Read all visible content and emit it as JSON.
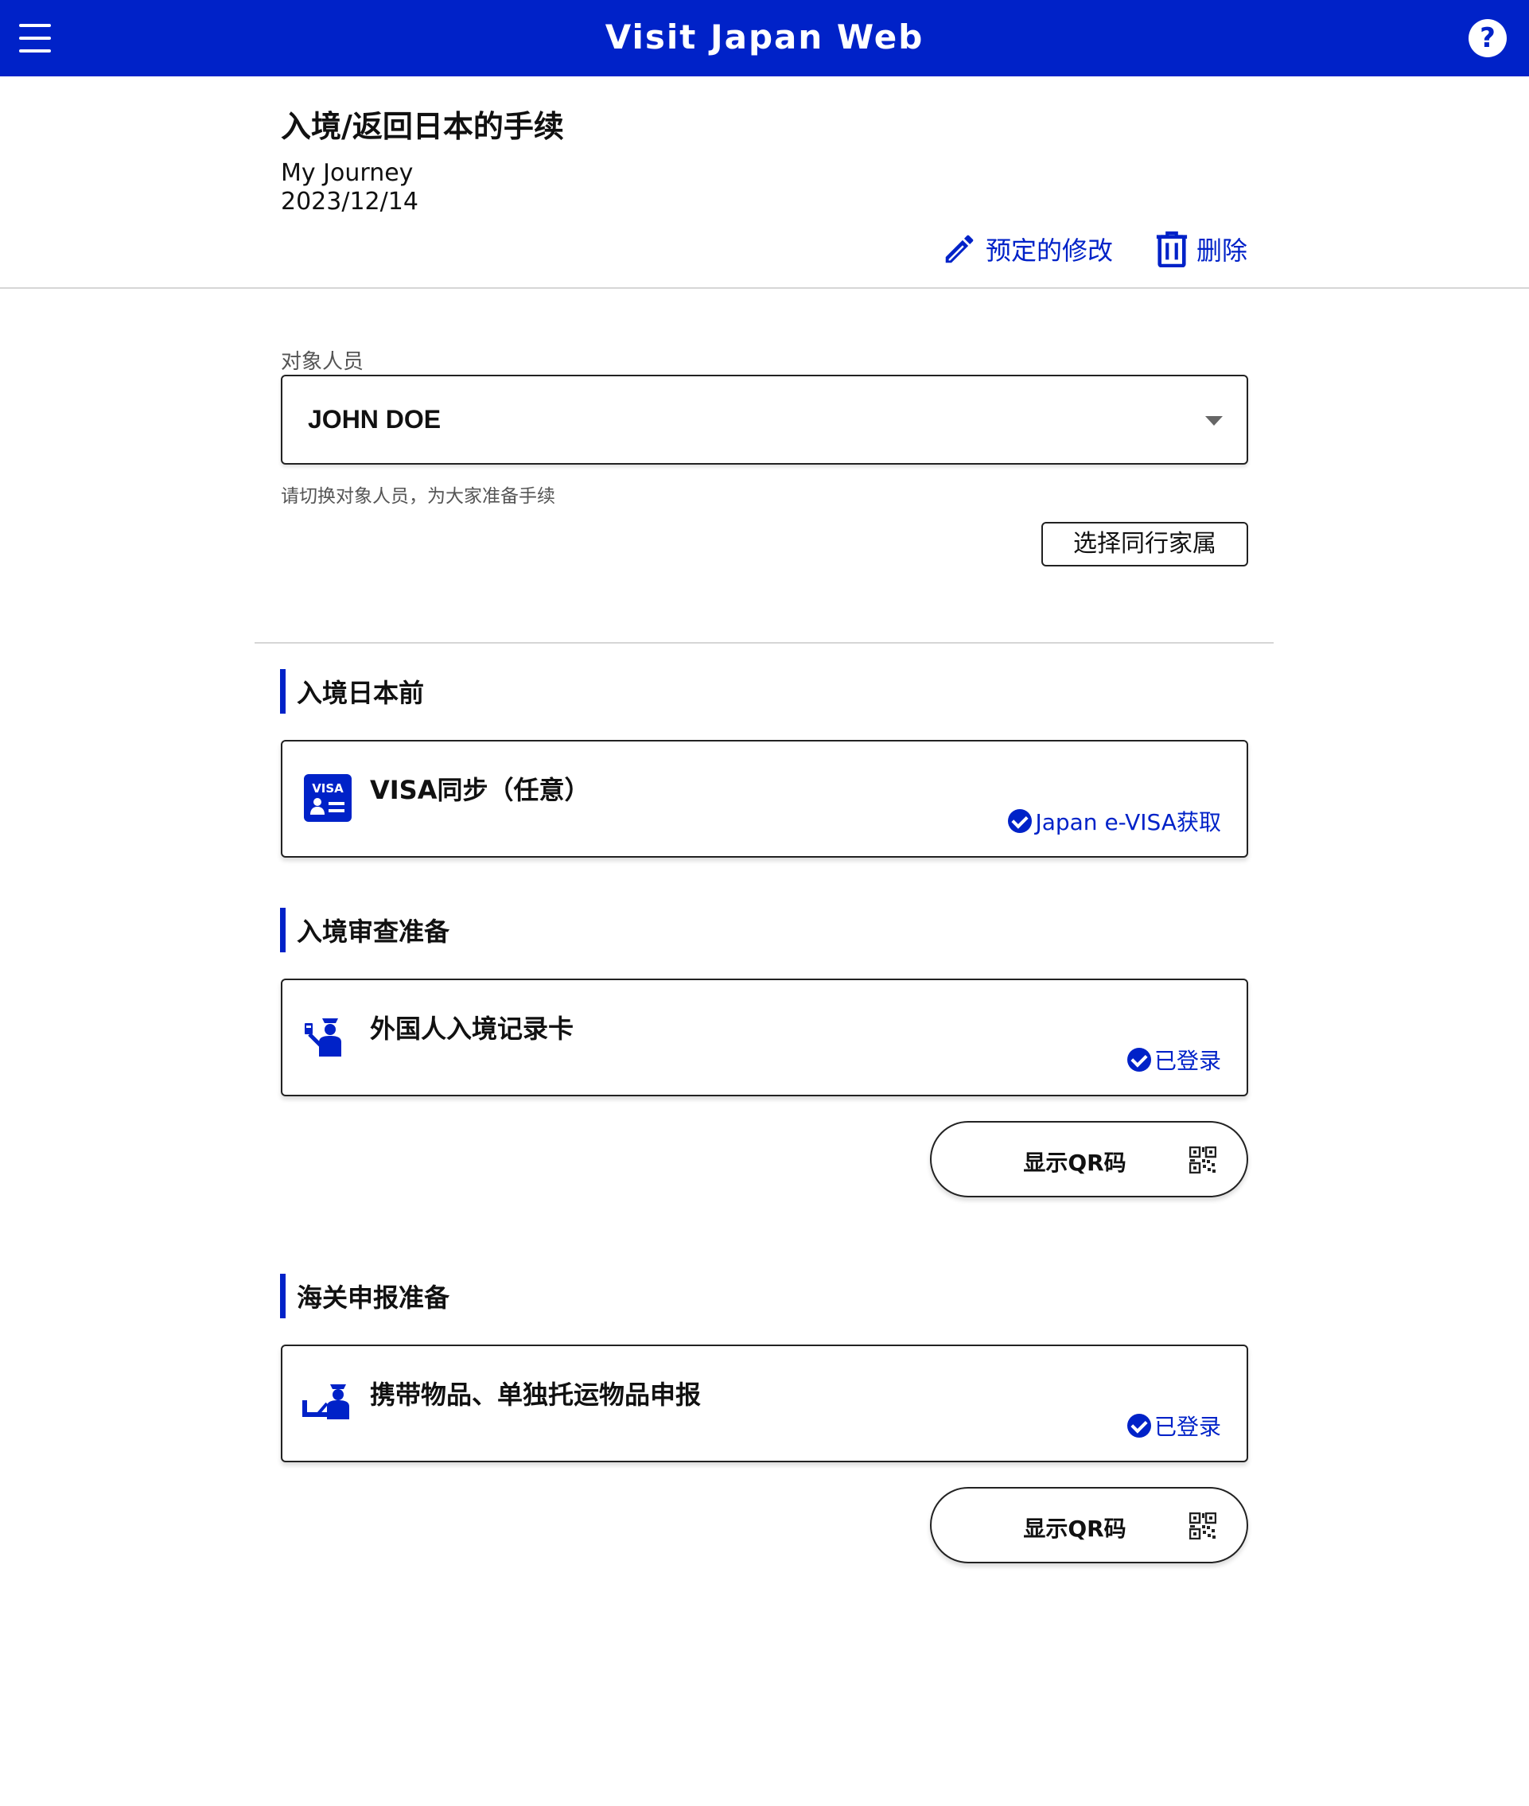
{
  "header": {
    "title": "Visit Japan Web",
    "menu_icon": "hamburger-menu-icon",
    "help_icon": "help-icon",
    "help_glyph": "?",
    "brand_color": "#0022c8"
  },
  "journey": {
    "page_title": "入境/返回日本的手续",
    "name": "My Journey",
    "date": "2023/12/14",
    "edit_label": "预定的修改",
    "delete_label": "删除"
  },
  "person": {
    "label": "对象人员",
    "selected": "JOHN DOE",
    "helper": "请切换对象人员，为大家准备手续",
    "family_button": "选择同行家属"
  },
  "sections": [
    {
      "heading": "入境日本前",
      "card": {
        "icon": "visa-icon",
        "icon_text": "VISA",
        "title": "VISA同步（任意）",
        "status": "Japan e-VISA获取"
      }
    },
    {
      "heading": "入境审查准备",
      "card": {
        "icon": "immigration-officer-icon",
        "title": "外国人入境记录卡",
        "status": "已登录"
      },
      "qr_button": "显示QR码"
    },
    {
      "heading": "海关申报准备",
      "card": {
        "icon": "customs-officer-icon",
        "title": "携带物品、单独托运物品申报",
        "status": "已登录"
      },
      "qr_button": "显示QR码"
    }
  ]
}
